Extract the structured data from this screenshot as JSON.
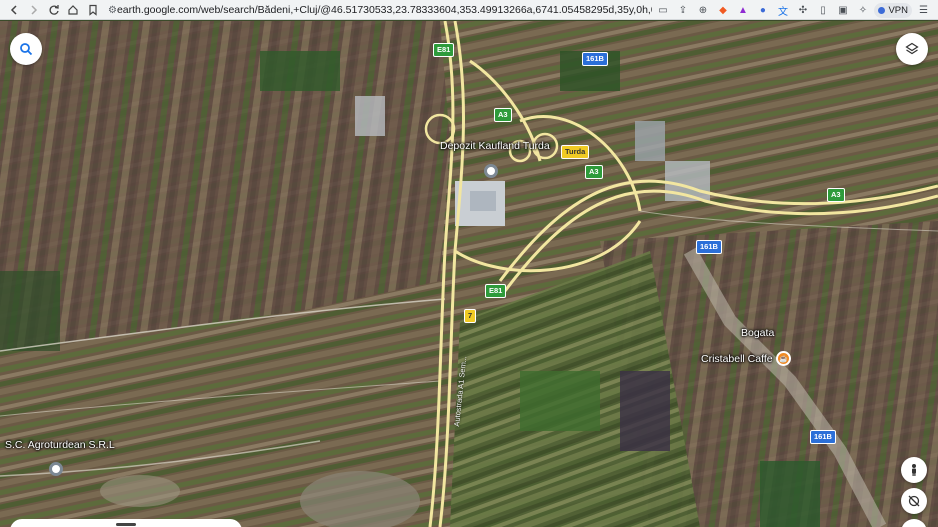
{
  "browser": {
    "url": "earth.google.com/web/search/Bădeni,+Cluj/@46.51730533,23.78333604,353.49913266a,6741.05458295d,35y,0h,0t,...",
    "vpn_label": "VPN"
  },
  "map": {
    "places": {
      "depozit": "Depozit Kaufland Turda",
      "bogata": "Bogata",
      "cristabell": "Cristabell Caffe",
      "agroturdean": "S.C. Agroturdean S.R.L"
    },
    "road_label": "Autostrada A1 Sem...",
    "shields": {
      "e81_top": "E81",
      "e81_mid": "E81",
      "a3_top": "A3",
      "a3_mid": "A3",
      "a3_right": "A3",
      "r161b_top": "161B",
      "r161b_mid": "161B",
      "r161b_bottom": "161B",
      "turda": "Turda",
      "r7": "7"
    }
  },
  "colors": {
    "shield_green": "#2e9b3b",
    "shield_blue": "#2b6fd8",
    "shield_yellow": "#f1cb24",
    "pin_orange": "#f08a24"
  },
  "icons": {
    "search": "search-icon",
    "layers": "layers-icon",
    "pegman": "pegman-icon",
    "compass": "compass-reset-icon"
  }
}
